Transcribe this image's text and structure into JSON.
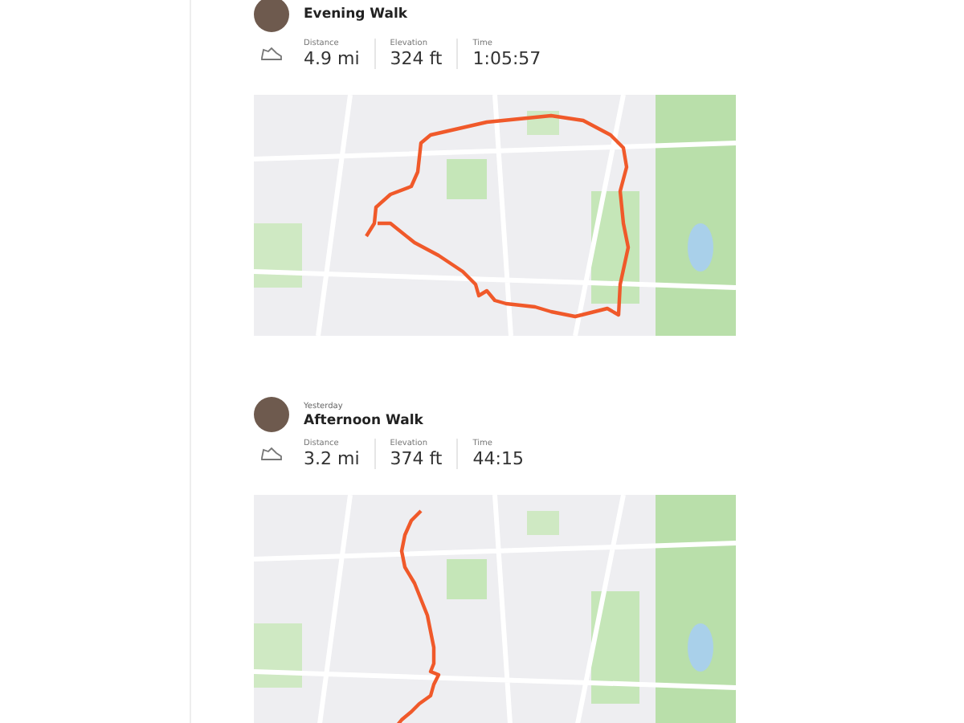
{
  "activities": [
    {
      "title": "Evening Walk",
      "stats": [
        {
          "label": "Distance",
          "value": "4.9 mi"
        },
        {
          "label": "Elevation",
          "value": "324 ft"
        },
        {
          "label": "Time",
          "value": "1:05:57"
        }
      ]
    },
    {
      "date": "Yesterday",
      "title": "Afternoon Walk",
      "stats": [
        {
          "label": "Distance",
          "value": "3.2 mi"
        },
        {
          "label": "Elevation",
          "value": "374 ft"
        },
        {
          "label": "Time",
          "value": "44:15"
        }
      ]
    }
  ]
}
